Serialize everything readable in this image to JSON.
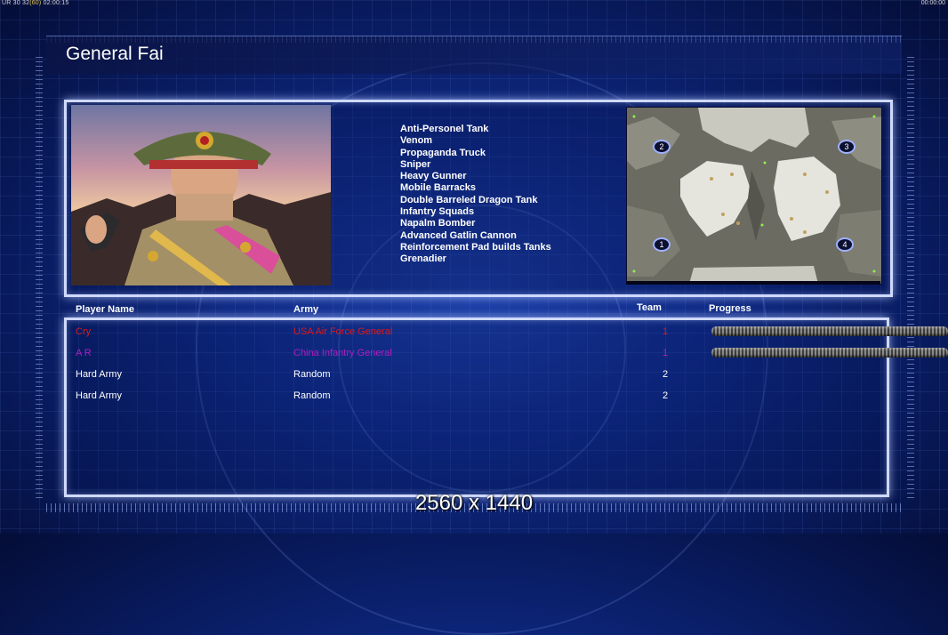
{
  "hud": {
    "left_prefix": "UR 30 32",
    "left_highlight": "(60)",
    "left_time": "02:00:15",
    "right_time": "00:00:00"
  },
  "general": {
    "name": "General Fai"
  },
  "units": [
    "Anti-Personel Tank",
    "Venom",
    "Propaganda Truck",
    "Sniper",
    "Heavy Gunner",
    "Mobile Barracks",
    "Double Barreled Dragon Tank",
    "Infantry Squads",
    "Napalm Bomber",
    "Advanced Gatlin Cannon",
    "Reinforcement Pad builds Tanks",
    "Grenadier"
  ],
  "map": {
    "starts": [
      "1",
      "2",
      "3",
      "4"
    ]
  },
  "table": {
    "headers": {
      "player": "Player Name",
      "army": "Army",
      "team": "Team",
      "progress": "Progress"
    },
    "rows": [
      {
        "player": "Cry",
        "army": "USA Air Force General",
        "team": "1",
        "color": "#e01818",
        "progress": 1
      },
      {
        "player": "A R",
        "army": "China Infantry General",
        "team": "1",
        "color": "#b01ec0",
        "progress": 1
      },
      {
        "player": "Hard Army",
        "army": "Random",
        "team": "2",
        "color": "#ffffff",
        "progress": null
      },
      {
        "player": "Hard Army",
        "army": "Random",
        "team": "2",
        "color": "#ffffff",
        "progress": null
      }
    ]
  },
  "resolution": "2560 x 1440"
}
